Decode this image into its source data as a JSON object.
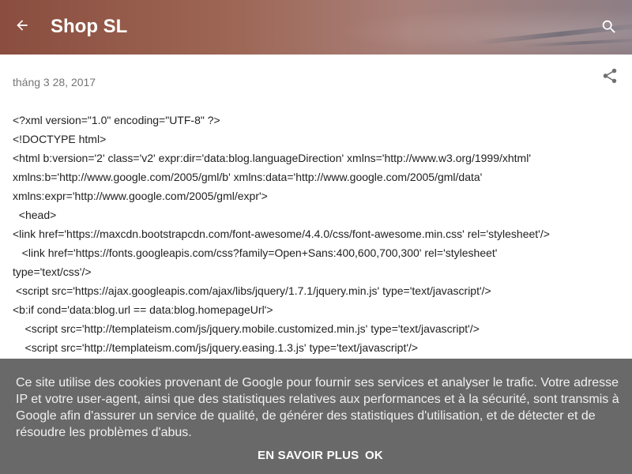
{
  "header": {
    "title": "Shop SL",
    "back_icon": "arrow-left-icon",
    "search_icon": "search-icon"
  },
  "post": {
    "date": "tháng 3 28, 2017",
    "share_icon": "share-icon",
    "lines": [
      "<?xml version=\"1.0\" encoding=\"UTF-8\" ?>",
      "<!DOCTYPE html>",
      "<html b:version='2' class='v2' expr:dir='data:blog.languageDirection' xmlns='http://www.w3.org/1999/xhtml'",
      "xmlns:b='http://www.google.com/2005/gml/b' xmlns:data='http://www.google.com/2005/gml/data'",
      "xmlns:expr='http://www.google.com/2005/gml/expr'>",
      "  <head>",
      "<link href='https://maxcdn.bootstrapcdn.com/font-awesome/4.4.0/css/font-awesome.min.css' rel='stylesheet'/>",
      "   <link href='https://fonts.googleapis.com/css?family=Open+Sans:400,600,700,300' rel='stylesheet'",
      "type='text/css'/>",
      " <script src='https://ajax.googleapis.com/ajax/libs/jquery/1.7.1/jquery.min.js' type='text/javascript'/>",
      "<b:if cond='data:blog.url == data:blog.homepageUrl'>",
      "    <script src='http://templateism.com/js/jquery.mobile.customized.min.js' type='text/javascript'/>",
      "    <script src='http://templateism.com/js/jquery.easing.1.3.js' type='text/javascript'/>"
    ]
  },
  "cookie_notice": {
    "text": "Ce site utilise des cookies provenant de Google pour fournir ses services et analyser le trafic. Votre adresse IP et votre user-agent, ainsi que des statistiques relatives aux performances et à la sécurité, sont transmis à Google afin d'assurer un service de qualité, de générer des statistiques d'utilisation, et de détecter et de résoudre les problèmes d'abus.",
    "learn_more_label": "EN SAVOIR PLUS",
    "ok_label": "OK"
  },
  "colors": {
    "header_start": "#8a4d3f",
    "header_end": "#8d7f86",
    "cookie_bg": "#646464",
    "date_text": "#757575"
  }
}
